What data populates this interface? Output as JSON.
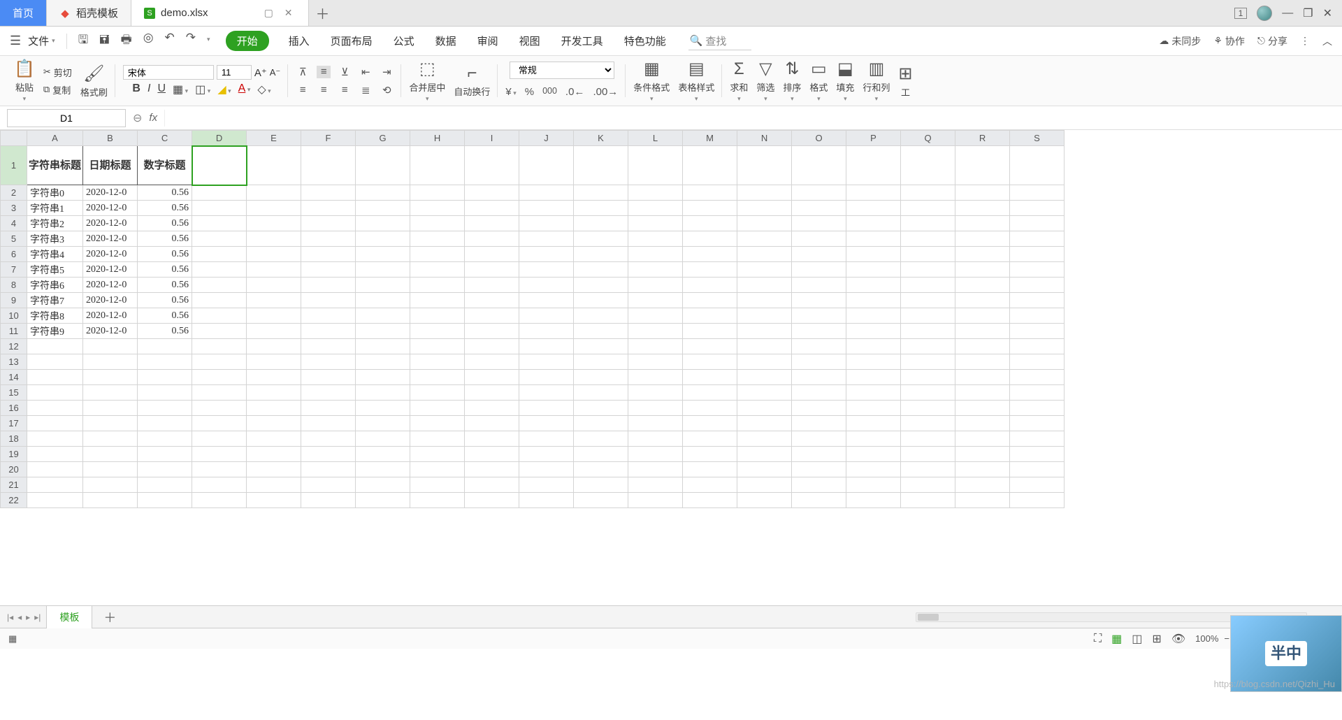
{
  "tabs": {
    "home": "首页",
    "template": "稻壳模板",
    "file": "demo.xlsx"
  },
  "window": {
    "badge": "1"
  },
  "menu": {
    "file": "文件",
    "items": [
      "开始",
      "插入",
      "页面布局",
      "公式",
      "数据",
      "审阅",
      "视图",
      "开发工具",
      "特色功能"
    ],
    "search_placeholder": "查找",
    "right": {
      "sync": "未同步",
      "collab": "协作",
      "share": "分享"
    }
  },
  "ribbon": {
    "paste": "粘贴",
    "cut": "剪切",
    "copy": "复制",
    "fmtpainter": "格式刷",
    "font": "宋体",
    "size": "11",
    "merge": "合并居中",
    "wrap": "自动换行",
    "numfmt": "常规",
    "cond": "条件格式",
    "tablestyle": "表格样式",
    "sum": "求和",
    "filter": "筛选",
    "sort": "排序",
    "format": "格式",
    "fill": "填充",
    "rowcol": "行和列",
    "tool": "工"
  },
  "fbar": {
    "name": "D1",
    "formula": ""
  },
  "grid": {
    "cols": [
      "A",
      "B",
      "C",
      "D",
      "E",
      "F",
      "G",
      "H",
      "I",
      "J",
      "K",
      "L",
      "M",
      "N",
      "O",
      "P",
      "Q",
      "R",
      "S"
    ],
    "headers": [
      "字符串标题",
      "日期标题",
      "数字标题"
    ],
    "rows": [
      {
        "a": "字符串0",
        "b": "2020-12-0",
        "c": "0.56"
      },
      {
        "a": "字符串1",
        "b": "2020-12-0",
        "c": "0.56"
      },
      {
        "a": "字符串2",
        "b": "2020-12-0",
        "c": "0.56"
      },
      {
        "a": "字符串3",
        "b": "2020-12-0",
        "c": "0.56"
      },
      {
        "a": "字符串4",
        "b": "2020-12-0",
        "c": "0.56"
      },
      {
        "a": "字符串5",
        "b": "2020-12-0",
        "c": "0.56"
      },
      {
        "a": "字符串6",
        "b": "2020-12-0",
        "c": "0.56"
      },
      {
        "a": "字符串7",
        "b": "2020-12-0",
        "c": "0.56"
      },
      {
        "a": "字符串8",
        "b": "2020-12-0",
        "c": "0.56"
      },
      {
        "a": "字符串9",
        "b": "2020-12-0",
        "c": "0.56"
      }
    ],
    "selected": "D1",
    "total_rows": 22
  },
  "sheettabs": {
    "active": "模板"
  },
  "status": {
    "zoom": "100%"
  },
  "promo": {
    "text": "半中"
  },
  "watermark": "https://blog.csdn.net/Qizhi_Hu"
}
